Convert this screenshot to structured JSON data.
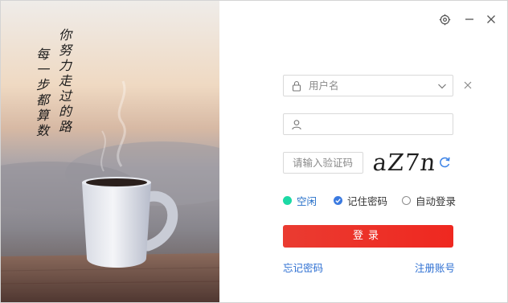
{
  "artwork": {
    "calligraphy_line1": "你努力走过的路",
    "calligraphy_line2": "每一步都算数"
  },
  "window_controls": [
    "settings-icon",
    "minimize-icon",
    "close-icon"
  ],
  "form": {
    "username_placeholder": "用户名",
    "password_placeholder": "",
    "captcha_placeholder": "请输入验证码",
    "captcha_code": "aZ7n"
  },
  "options": {
    "status_label": "空闲",
    "remember_label": "记住密码",
    "remember_checked": true,
    "auto_login_label": "自动登录",
    "auto_login_checked": false
  },
  "login_button": "登录",
  "links": {
    "forgot_password": "忘记密码",
    "register": "注册账号"
  },
  "colors": {
    "accent_red": "#ec3226",
    "link_blue": "#2d6fd2",
    "status_green": "#1dd9a5"
  }
}
